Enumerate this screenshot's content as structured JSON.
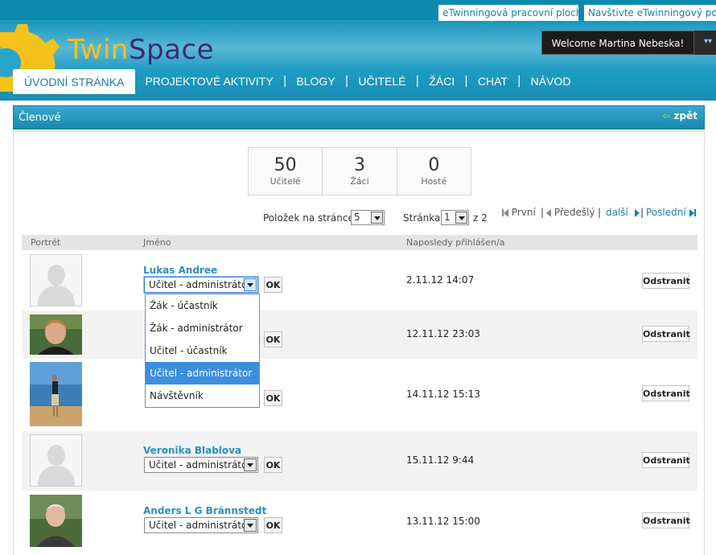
{
  "topbar": {
    "links": [
      "eTwinningová pracovní plocha",
      "Navštivte eTwinningový portál"
    ]
  },
  "brand": {
    "twin": "Twin",
    "space": "Space"
  },
  "welcome": "Welcome Martina Nebeska!",
  "nav": {
    "items": [
      {
        "label": "ÚVODNÍ STRÁNKA",
        "active": true
      },
      {
        "label": "PROJEKTOVÉ AKTIVITY",
        "active": false
      },
      {
        "label": "BLOGY",
        "active": false
      },
      {
        "label": "UČITELÉ",
        "active": false
      },
      {
        "label": "ŽÁCI",
        "active": false
      },
      {
        "label": "CHAT",
        "active": false
      },
      {
        "label": "NÁVOD",
        "active": false
      }
    ],
    "separator": "|"
  },
  "panel": {
    "title": "Členové",
    "back": "zpět"
  },
  "stats": [
    {
      "value": "50",
      "label": "Učitelé"
    },
    {
      "value": "3",
      "label": "Žáci"
    },
    {
      "value": "0",
      "label": "Hosté"
    }
  ],
  "pager": {
    "per_page_label": "Položek na stránce",
    "per_page_value": "5",
    "page_label": "Stránka",
    "page_value": "1",
    "of_label": "z 2",
    "first": "První",
    "prev": "Předešlý",
    "next": "další",
    "last": "Poslední"
  },
  "table": {
    "headers": [
      "Portrét",
      "Jméno",
      "Naposledy přihlášen/a"
    ],
    "ok_label": "OK",
    "remove_label": "Odstranit",
    "rows": [
      {
        "name": "Lukas Andree",
        "role": "Učitel - administrátor",
        "last": "2.11.12 14:07",
        "photo": "placeholder"
      },
      {
        "name": "",
        "role": "",
        "last": "12.11.12 23:03",
        "photo": "woman-portrait"
      },
      {
        "name": "",
        "role": "",
        "last": "14.11.12 15:13",
        "photo": "beach-photo"
      },
      {
        "name": "Veronika Blablova",
        "role": "Učitel - administrátor",
        "last": "15.11.12 9:44",
        "photo": "placeholder"
      },
      {
        "name": "Anders L G Brännstedt",
        "role": "Učitel - administrátor",
        "last": "13.11.12 15:00",
        "photo": "man-portrait"
      }
    ]
  },
  "role_dropdown": {
    "options": [
      "Žák - účastník",
      "Žák - administrátor",
      "Učitel - účastník",
      "Učitel - administrátor",
      "Návštěvník"
    ],
    "selected_index": 3
  },
  "colors": {
    "header_blue": "#1996bc",
    "link_blue": "#1a7fae",
    "logo_yellow": "#f4c21a",
    "logo_purple": "#3a2a7a",
    "selected_option": "#3d8ee0"
  }
}
